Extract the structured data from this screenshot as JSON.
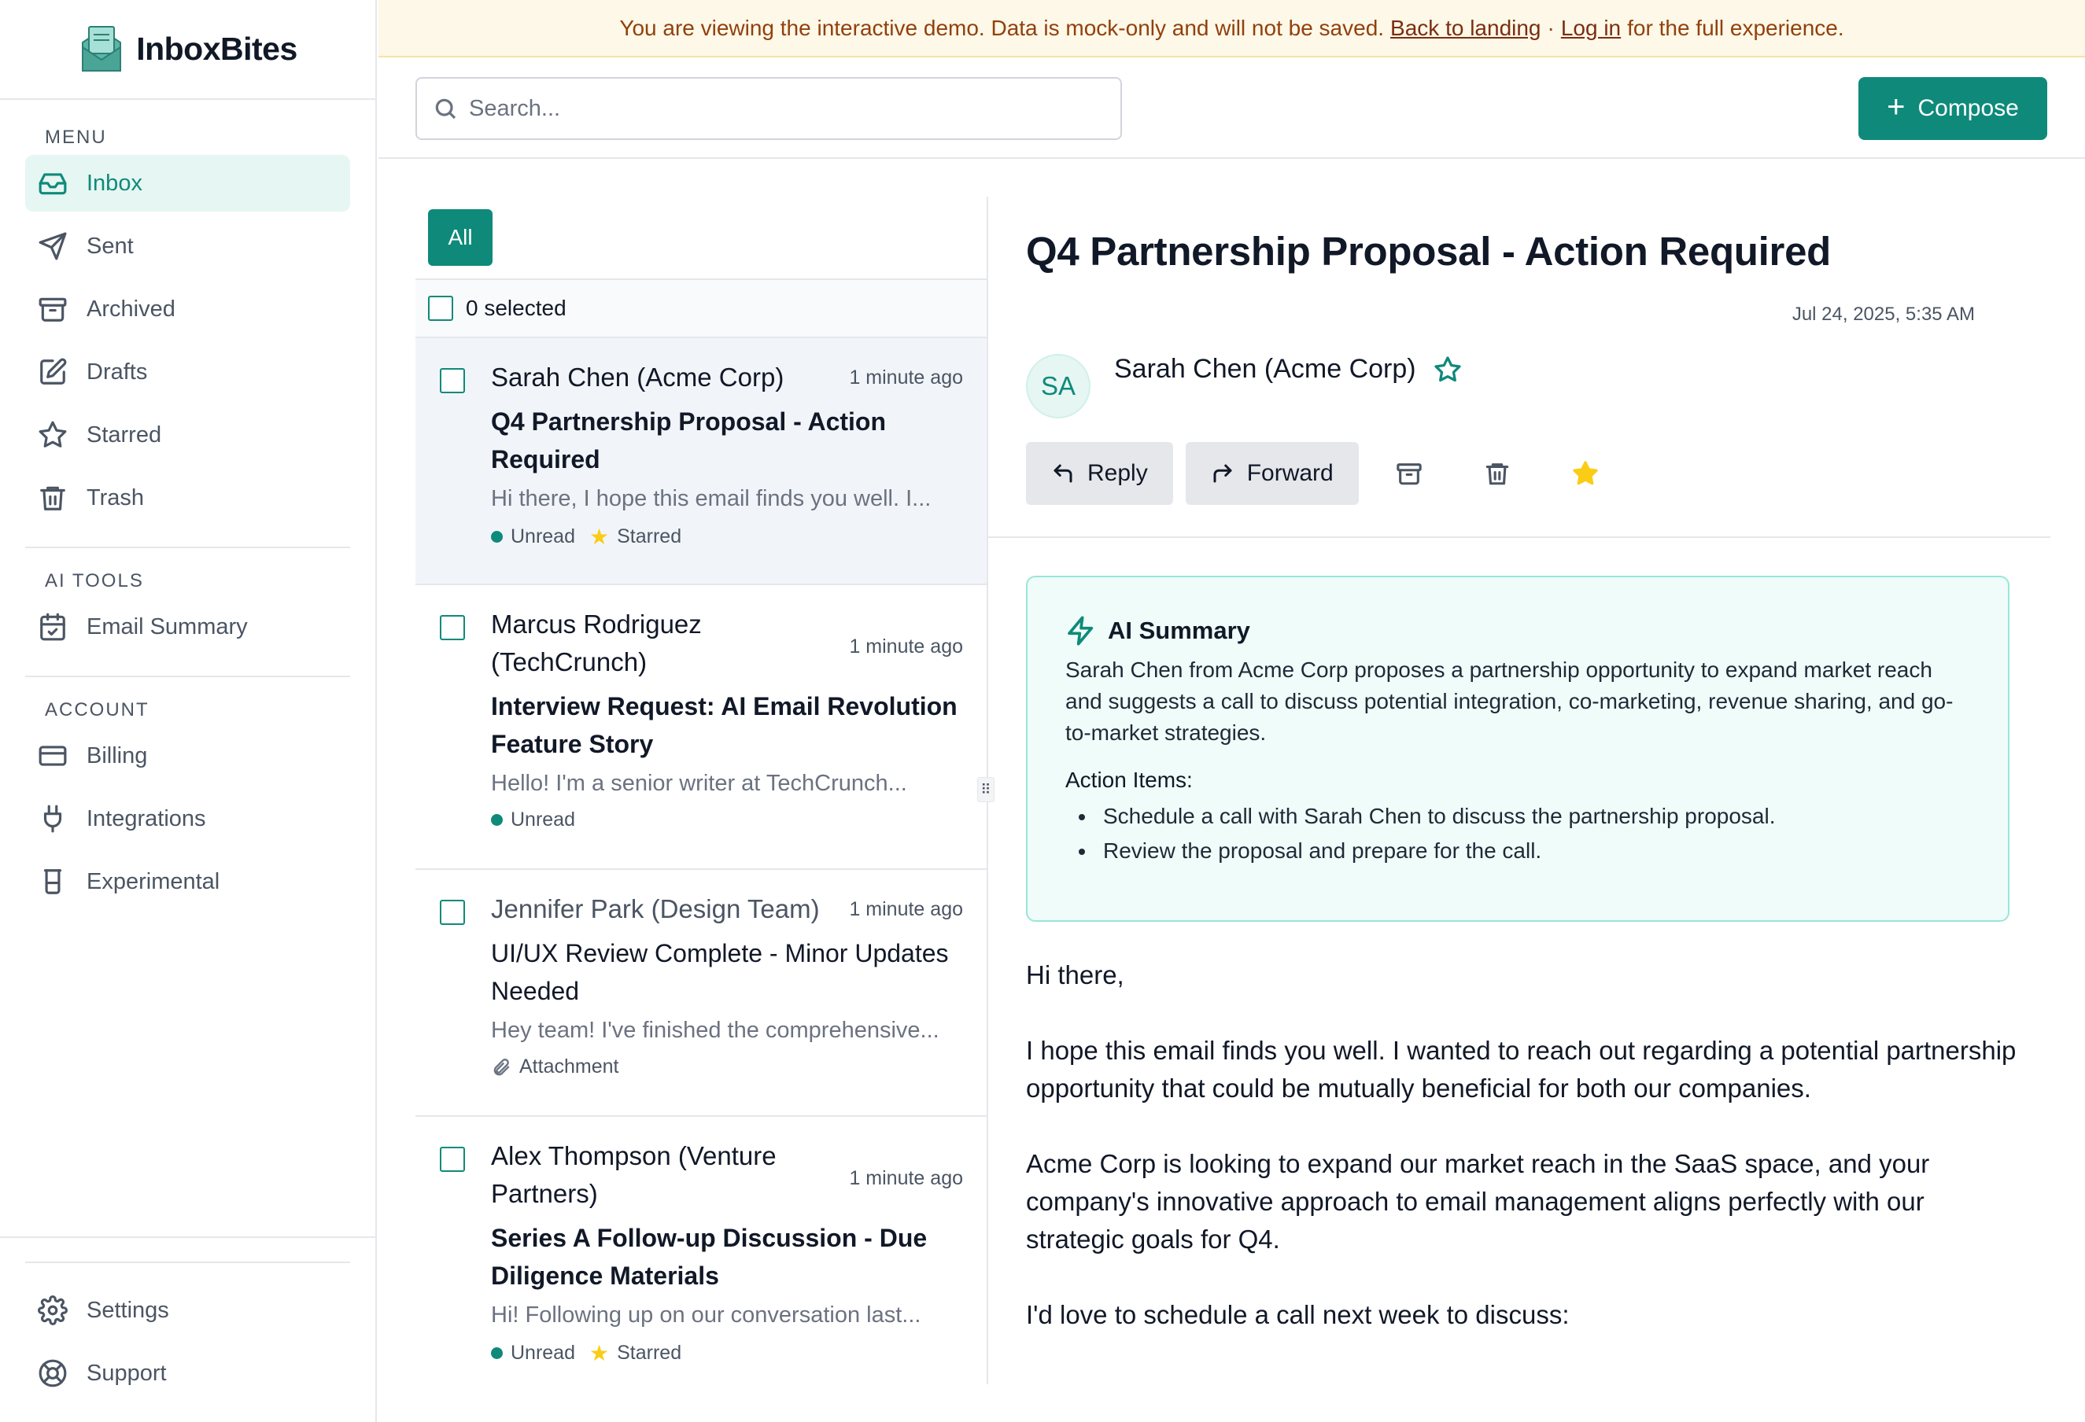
{
  "app": {
    "name": "InboxBites"
  },
  "banner": {
    "text": "You are viewing the interactive demo. Data is mock-only and will not be saved.",
    "back_link": "Back to landing",
    "separator": "·",
    "login_link": "Log in",
    "suffix": "for the full experience."
  },
  "sidebar": {
    "menu_label": "MENU",
    "menu": [
      {
        "label": "Inbox",
        "icon": "inbox-icon"
      },
      {
        "label": "Sent",
        "icon": "send-icon"
      },
      {
        "label": "Archived",
        "icon": "archive-icon"
      },
      {
        "label": "Drafts",
        "icon": "edit-icon"
      },
      {
        "label": "Starred",
        "icon": "star-icon"
      },
      {
        "label": "Trash",
        "icon": "trash-icon"
      }
    ],
    "ai_label": "AI TOOLS",
    "ai": [
      {
        "label": "Email Summary",
        "icon": "calendar-check-icon"
      }
    ],
    "account_label": "ACCOUNT",
    "account": [
      {
        "label": "Billing",
        "icon": "credit-card-icon"
      },
      {
        "label": "Integrations",
        "icon": "plug-icon"
      },
      {
        "label": "Experimental",
        "icon": "flask-icon"
      }
    ],
    "footer": [
      {
        "label": "Settings",
        "icon": "gear-icon"
      },
      {
        "label": "Support",
        "icon": "lifebuoy-icon"
      }
    ]
  },
  "search": {
    "placeholder": "Search...",
    "value": ""
  },
  "compose": {
    "label": "Compose"
  },
  "list": {
    "filter_label": "All",
    "selected_text": "0 selected",
    "emails": [
      {
        "from": "Sarah Chen (Acme Corp)",
        "time": "1 minute ago",
        "subject": "Q4 Partnership Proposal - Action Required",
        "preview": "Hi there, I hope this email finds you well. I...",
        "unread_label": "Unread",
        "starred_label": "Starred"
      },
      {
        "from": "Marcus Rodriguez (TechCrunch)",
        "time": "1 minute ago",
        "subject": "Interview Request: AI Email Revolution Feature Story",
        "preview": "Hello! I'm a senior writer at TechCrunch...",
        "unread_label": "Unread"
      },
      {
        "from": "Jennifer Park (Design Team)",
        "time": "1 minute ago",
        "subject": "UI/UX Review Complete - Minor Updates Needed",
        "preview": "Hey team! I've finished the comprehensive...",
        "attachment_label": "Attachment"
      },
      {
        "from": "Alex Thompson (Venture Partners)",
        "time": "1 minute ago",
        "subject": "Series A Follow-up Discussion - Due Diligence Materials",
        "preview": "Hi! Following up on our conversation last...",
        "unread_label": "Unread",
        "starred_label": "Starred"
      }
    ]
  },
  "detail": {
    "title": "Q4 Partnership Proposal - Action Required",
    "date": "Jul 24, 2025, 5:35 AM",
    "avatar_initials": "SA",
    "sender": "Sarah Chen (Acme Corp)",
    "reply_label": "Reply",
    "forward_label": "Forward",
    "ai_summary": {
      "title": "AI Summary",
      "text": "Sarah Chen from Acme Corp proposes a partnership opportunity to expand market reach and suggests a call to discuss potential integration, co-marketing, revenue sharing, and go-to-market strategies.",
      "items_label": "Action Items:",
      "items": [
        "Schedule a call with Sarah Chen to discuss the partnership proposal.",
        "Review the proposal and prepare for the call."
      ]
    },
    "body": [
      "Hi there,",
      "I hope this email finds you well. I wanted to reach out regarding a potential partnership opportunity that could be mutually beneficial for both our companies.",
      "Acme Corp is looking to expand our market reach in the SaaS space, and your company's innovative approach to email management aligns perfectly with our strategic goals for Q4.",
      "I'd love to schedule a call next week to discuss:"
    ]
  },
  "colors": {
    "accent": "#0f8a7a",
    "banner_bg": "#fdf8e7",
    "star": "#facc15"
  }
}
